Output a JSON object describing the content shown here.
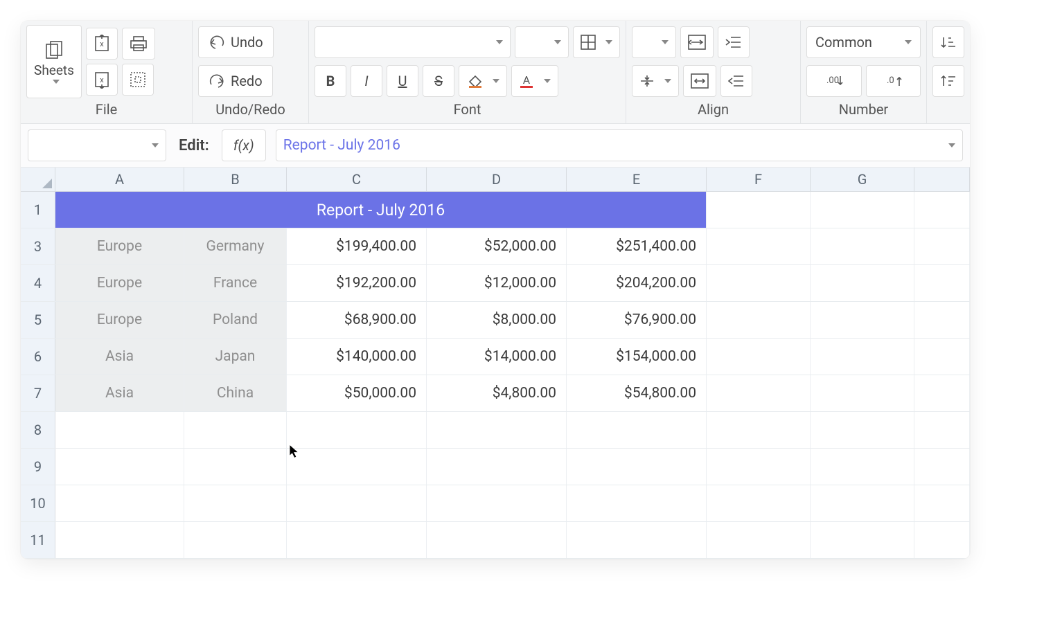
{
  "toolbar": {
    "sheets_label": "Sheets",
    "undo_label": "Undo",
    "redo_label": "Redo",
    "number_format_label": "Common",
    "groups": {
      "file": "File",
      "undo": "Undo/Redo",
      "font": "Font",
      "align": "Align",
      "number": "Number"
    }
  },
  "formula_bar": {
    "name_box": "",
    "edit_label": "Edit:",
    "fx_label": "f(x)",
    "formula": "Report - July 2016"
  },
  "grid": {
    "columns": [
      "A",
      "B",
      "C",
      "D",
      "E",
      "F",
      "G",
      ""
    ],
    "title_cell": "Report - July 2016",
    "row_numbers": [
      "1",
      "3",
      "4",
      "5",
      "6",
      "7",
      "8",
      "9",
      "10",
      "11"
    ],
    "data_rows": [
      {
        "region": "Europe",
        "country": "Germany",
        "c": "$199,400.00",
        "d": "$52,000.00",
        "e": "$251,400.00"
      },
      {
        "region": "Europe",
        "country": "France",
        "c": "$192,200.00",
        "d": "$12,000.00",
        "e": "$204,200.00"
      },
      {
        "region": "Europe",
        "country": "Poland",
        "c": "$68,900.00",
        "d": "$8,000.00",
        "e": "$76,900.00"
      },
      {
        "region": "Asia",
        "country": "Japan",
        "c": "$140,000.00",
        "d": "$14,000.00",
        "e": "$154,000.00"
      },
      {
        "region": "Asia",
        "country": "China",
        "c": "$50,000.00",
        "d": "$4,800.00",
        "e": "$54,800.00"
      }
    ]
  }
}
